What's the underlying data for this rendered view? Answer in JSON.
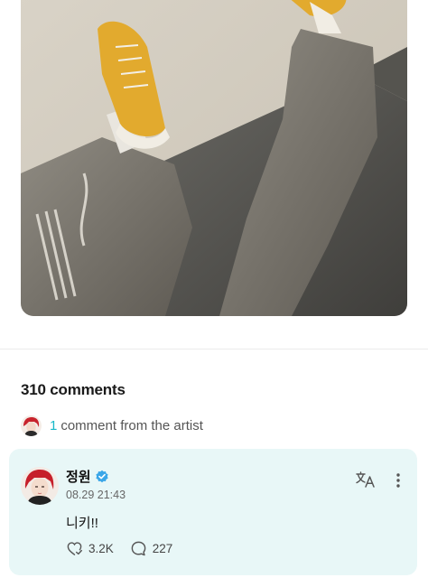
{
  "post": {
    "comment_count_label": "310 comments"
  },
  "artist_comments": {
    "count": "1",
    "label": "comment from the artist"
  },
  "comment": {
    "author": "정원",
    "timestamp": "08.29 21:43",
    "text": "니키!!",
    "likes": "3.2K",
    "replies": "227",
    "verified": true
  },
  "icons": {
    "translate": "translate-icon",
    "more": "more-vertical-icon",
    "like": "like-icon",
    "reply": "reply-icon",
    "verified": "verified-badge-icon"
  },
  "colors": {
    "accent": "#16b8c8",
    "card_background": "#e8f7f7",
    "verified": "#3aa6e8"
  }
}
